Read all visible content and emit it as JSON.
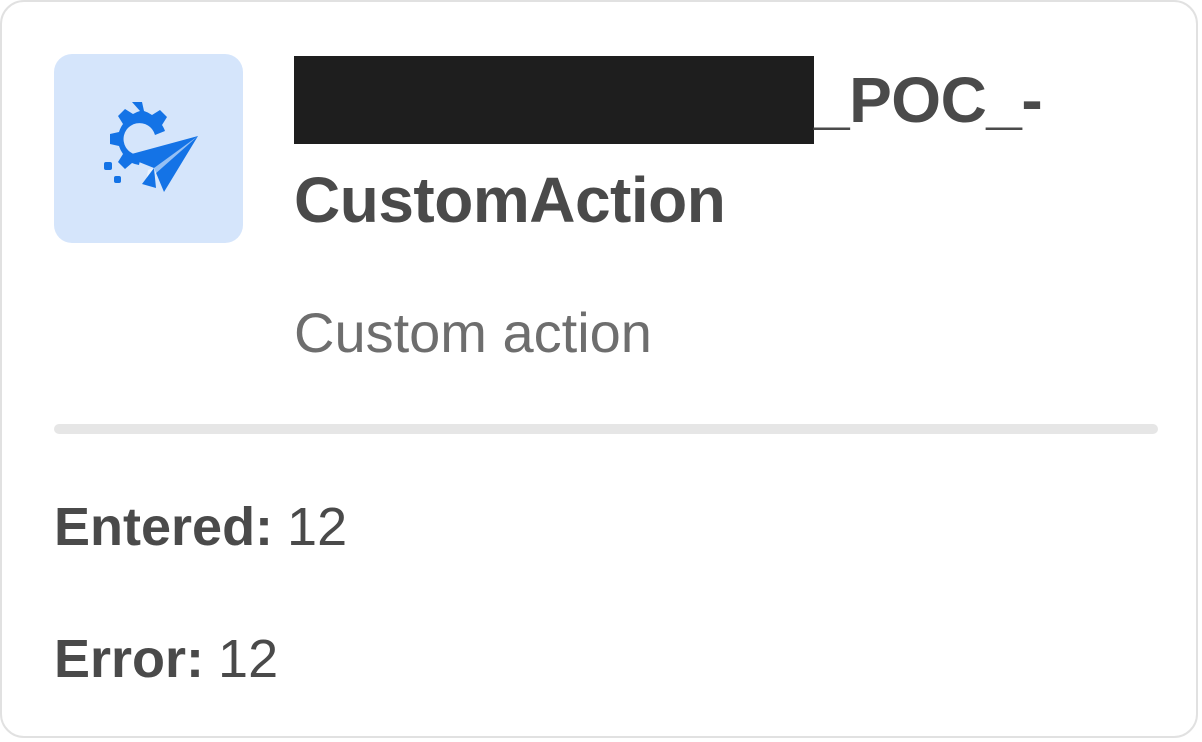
{
  "node": {
    "icon": "gear-paper-plane-icon",
    "accent_color": "#1473e6",
    "icon_bg_color": "#d5e5fb",
    "title_suffix": "_POC_-",
    "title_line2": "CustomAction",
    "subtitle": "Custom action"
  },
  "stats": {
    "entered_label": "Entered:",
    "entered_value": "12",
    "error_label": "Error:",
    "error_value": "12"
  }
}
